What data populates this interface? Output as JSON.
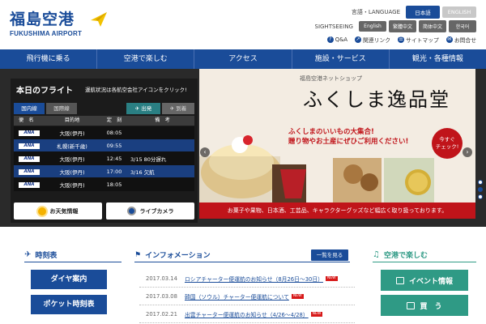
{
  "header": {
    "logo_jp": "福島空港",
    "logo_en": "FUKUSHIMA AIRPORT",
    "language_label": "言語・LANGUAGE",
    "language_buttons": [
      "日本語",
      "ENGLISH"
    ],
    "sightseeing_label": "SIGHTSEEING",
    "sightseeing_buttons": [
      "English",
      "繁體中文",
      "简体中文",
      "한국어"
    ],
    "utility_links": [
      "Q&A",
      "関連リンク",
      "サイトマップ",
      "お問合せ"
    ]
  },
  "nav": {
    "items": [
      "飛行機に乗る",
      "空港で楽しむ",
      "アクセス",
      "施設・サービス",
      "観光・各種情報"
    ]
  },
  "flight": {
    "title": "本日のフライト",
    "note": "運航状況は各航空会社アイコンをクリック!",
    "tabs": [
      "国内線",
      "国際線"
    ],
    "direction_tabs": [
      "出発",
      "到着"
    ],
    "columns": [
      "便　名",
      "目的地",
      "定　刻",
      "備　考"
    ],
    "rows": [
      {
        "airline": "ANA",
        "dest": "大阪(伊丹)",
        "time": "08:05",
        "note": ""
      },
      {
        "airline": "ANA",
        "dest": "札幌(新千歳)",
        "time": "09:55",
        "note": ""
      },
      {
        "airline": "ANA",
        "dest": "大阪(伊丹)",
        "time": "12:45",
        "note": "3/15 80分遅れ"
      },
      {
        "airline": "ANA",
        "dest": "大阪(伊丹)",
        "time": "17:00",
        "note": "3/16 欠航"
      },
      {
        "airline": "ANA",
        "dest": "大阪(伊丹)",
        "time": "18:05",
        "note": ""
      }
    ],
    "weather_label": "お天気情報",
    "camera_label": "ライブカメラ"
  },
  "banner": {
    "shop_label": "福島空港ネットショップ",
    "brand": "ふくしま逸品堂",
    "tagline_1": "ふくしまのいいもの大集合!",
    "tagline_2": "贈り物やお土産にぜひご利用ください!",
    "badge_1": "今すぐ",
    "badge_2": "チェック!",
    "strip": "お菓子や果物、日本酒、工芸品、キャラクターグッズなど幅広く取り扱っております。",
    "slide_count": 3,
    "active_slide": 2
  },
  "timetable": {
    "heading": "時刻表",
    "buttons": [
      "ダイヤ案内",
      "ポケット時刻表"
    ]
  },
  "info": {
    "heading": "インフォメーション",
    "list_button": "一覧を見る",
    "items": [
      {
        "date": "2017.03.14",
        "text": "ロシアチャーター便運航のお知らせ（8月26日〜30日）",
        "new": "NEW"
      },
      {
        "date": "2017.03.08",
        "text": "韓国（ソウル）チャーター便運航について",
        "new": "NEW"
      },
      {
        "date": "2017.02.21",
        "text": "出雲チャーター便運航のお知らせ（4/26〜4/28）",
        "new": "NEW"
      }
    ]
  },
  "enjoy": {
    "heading": "空港で楽しむ",
    "buttons": [
      "イベント情報",
      "買　う"
    ]
  }
}
